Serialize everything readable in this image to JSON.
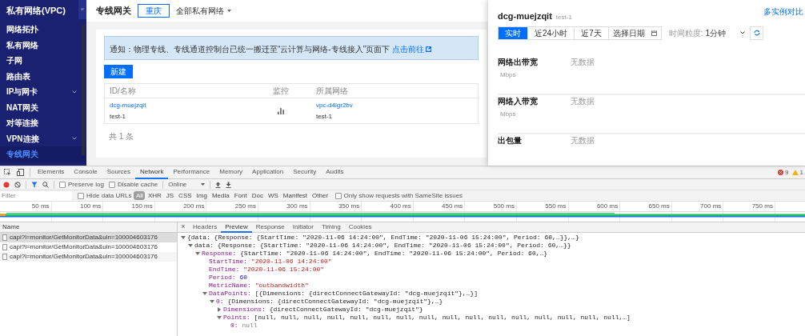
{
  "sidebar": {
    "title": "私有网络(VPC)",
    "collapse": "«",
    "items": [
      {
        "label": "网络拓扑",
        "kind": "page",
        "selected": false
      },
      {
        "label": "私有网络",
        "kind": "page",
        "selected": false
      },
      {
        "label": "子网",
        "kind": "page",
        "selected": false
      },
      {
        "label": "路由表",
        "kind": "page",
        "selected": false
      },
      {
        "label": "IP与网卡",
        "kind": "group",
        "selected": false
      },
      {
        "label": "NAT网关",
        "kind": "page",
        "selected": false
      },
      {
        "label": "对等连接",
        "kind": "page",
        "selected": false
      },
      {
        "label": "VPN连接",
        "kind": "group",
        "selected": false
      },
      {
        "label": "专线网关",
        "kind": "page",
        "selected": true
      }
    ]
  },
  "header": {
    "title": "专线网关",
    "region": "重庆",
    "vpc_filter": "全部私有网络"
  },
  "notice": {
    "text": "通知：物理专线、专线通道控制台已统一搬迁至“云计算与网络-专线接入”页面下",
    "link": "点击前往"
  },
  "create_button": "新建",
  "table": {
    "columns": [
      "ID/名称",
      "监控",
      "所属网络"
    ],
    "rows": [
      {
        "id": "dcg-muejzqit",
        "name": "test-1",
        "network_id": "vpc-d4igr2bv",
        "network_name": "test-1"
      }
    ]
  },
  "table_footer": "共 1 条",
  "monitor_panel": {
    "title": "dcg-muejzqit",
    "subtitle": "test-1",
    "compare_link": "多实例对比",
    "ranges": [
      {
        "label": "实时",
        "selected": true
      },
      {
        "label": "近24小时",
        "selected": false
      },
      {
        "label": "近7天",
        "selected": false
      }
    ],
    "date_picker": "选择日期",
    "granularity_label": "时间粒度:",
    "granularity": "1分钟",
    "metrics": [
      {
        "name": "网络出带宽",
        "unit": "Mbps",
        "status": "无数据"
      },
      {
        "name": "网络入带宽",
        "unit": "Mbps",
        "status": "无数据"
      },
      {
        "name": "出包量",
        "status": "无数据"
      }
    ]
  },
  "devtools": {
    "tabs": [
      {
        "label": "Elements",
        "selected": false
      },
      {
        "label": "Console",
        "selected": false
      },
      {
        "label": "Sources",
        "selected": false
      },
      {
        "label": "Network",
        "selected": true
      },
      {
        "label": "Performance",
        "selected": false
      },
      {
        "label": "Memory",
        "selected": false
      },
      {
        "label": "Application",
        "selected": false
      },
      {
        "label": "Security",
        "selected": false
      },
      {
        "label": "Audits",
        "selected": false
      }
    ],
    "errors": "9",
    "warnings": "1",
    "recording": true,
    "filter_open": true,
    "preserve_log": {
      "label": "Preserve log",
      "checked": false
    },
    "disable_cache": {
      "label": "Disable cache",
      "checked": false
    },
    "throttle": "Online",
    "filter": {
      "placeholder": "Filter"
    },
    "hide_data_urls": {
      "label": "Hide data URLs",
      "checked": false
    },
    "types": [
      {
        "label": "All",
        "selected": true
      },
      {
        "label": "XHR",
        "selected": false
      },
      {
        "label": "JS",
        "selected": false
      },
      {
        "label": "CSS",
        "selected": false
      },
      {
        "label": "Img",
        "selected": false
      },
      {
        "label": "Media",
        "selected": false
      },
      {
        "label": "Font",
        "selected": false
      },
      {
        "label": "Doc",
        "selected": false
      },
      {
        "label": "WS",
        "selected": false
      },
      {
        "label": "Manifest",
        "selected": false
      },
      {
        "label": "Other",
        "selected": false
      }
    ],
    "samesite": {
      "label": "Only show requests with SameSite issues",
      "checked": false
    },
    "ruler_ticks": [
      "50 ms",
      "100 ms",
      "150 ms",
      "200 ms",
      "250 ms",
      "300 ms",
      "350 ms",
      "400 ms",
      "450 ms",
      "500 ms",
      "550 ms",
      "600 ms",
      "650 ms",
      "700 ms",
      "750 ms"
    ],
    "list_header": "Name",
    "requests": [
      {
        "name": "capi?i=monitor/GetMonitorData&uin=100004603176",
        "selected": true
      },
      {
        "name": "capi?i=monitor/GetMonitorData&uin=100004603176",
        "selected": false
      },
      {
        "name": "capi?i=monitor/GetMonitorData&uin=100004603176",
        "selected": false
      }
    ],
    "close": "×",
    "detail_tabs": [
      {
        "label": "Headers",
        "selected": false
      },
      {
        "label": "Preview",
        "selected": true
      },
      {
        "label": "Response",
        "selected": false
      },
      {
        "label": "Initiator",
        "selected": false
      },
      {
        "label": "Timing",
        "selected": false
      },
      {
        "label": "Cookies",
        "selected": false
      }
    ],
    "preview": {
      "summary": "{data: {Response: {StartTime: \"2020-11-06 14:24:00\", EndTime: \"2020-11-06 15:24:00\", Period: 60,…}},…}",
      "expanded": true,
      "children": [
        {
          "label": "data:",
          "summary": "{Response: {StartTime: \"2020-11-06 14:24:00\", EndTime: \"2020-11-06 15:24:00\", Period: 60,…}}",
          "expanded": true,
          "children": [
            {
              "label": "Response:",
              "summary": "{StartTime: \"2020-11-06 14:24:00\", EndTime: \"2020-11-06 15:24:00\", Period: 60,…}",
              "expanded": true,
              "children": [
                {
                  "label": "StartTime:",
                  "value": "\"2020-11-06 14:24:00\"",
                  "kind": "string"
                },
                {
                  "label": "EndTime:",
                  "value": "\"2020-11-06 15:24:00\"",
                  "kind": "string"
                },
                {
                  "label": "Period:",
                  "value": "60",
                  "kind": "number"
                },
                {
                  "label": "MetricName:",
                  "value": "\"outbandwidth\"",
                  "kind": "string"
                },
                {
                  "label": "DataPoints:",
                  "summary": "[{Dimensions: {directConnectGatewayId: \"dcg-muejzqit\"},…}]",
                  "expanded": true,
                  "children": [
                    {
                      "label": "0:",
                      "summary": "{Dimensions: {directConnectGatewayId: \"dcg-muejzqit\"},…}",
                      "expanded": true,
                      "children": [
                        {
                          "label": "Dimensions:",
                          "summary": "{directConnectGatewayId: \"dcg-muejzqit\"}",
                          "expanded": false
                        },
                        {
                          "label": "Points:",
                          "summary": "[null, null, null, null, null, null, null, null, null, null, null, null, null, null, null, null,…]",
                          "expanded": true,
                          "children": [
                            {
                              "label": "0:",
                              "value": "null",
                              "kind": "null"
                            }
                          ]
                        }
                      ]
                    }
                  ]
                }
              ]
            }
          ]
        }
      ]
    }
  }
}
